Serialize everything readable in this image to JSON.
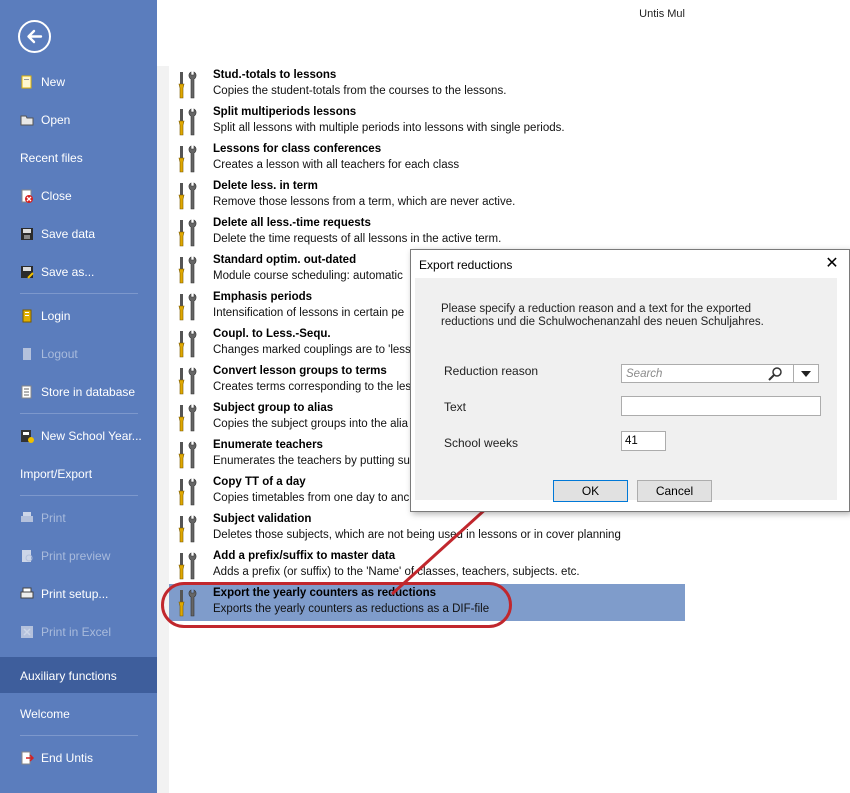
{
  "app": {
    "title": "Untis Mul"
  },
  "sidebar": {
    "items": [
      {
        "label": "New",
        "icon": "new-doc-icon",
        "disabled": false
      },
      {
        "label": "Open",
        "icon": "open-folder-icon",
        "disabled": false
      },
      {
        "label": "Recent files",
        "icon": "",
        "disabled": false
      },
      {
        "label": "Close",
        "icon": "close-doc-icon",
        "disabled": false
      },
      {
        "label": "Save data",
        "icon": "save-icon",
        "disabled": false
      },
      {
        "label": "Save as...",
        "icon": "save-as-icon",
        "disabled": false
      },
      {
        "label": "Login",
        "icon": "login-icon",
        "disabled": false
      },
      {
        "label": "Logout",
        "icon": "logout-icon",
        "disabled": true
      },
      {
        "label": "Store in database",
        "icon": "database-icon",
        "disabled": false
      },
      {
        "label": "New School Year...",
        "icon": "new-year-icon",
        "disabled": false
      },
      {
        "label": "Import/Export",
        "icon": "",
        "disabled": false
      },
      {
        "label": "Print",
        "icon": "print-icon",
        "disabled": true
      },
      {
        "label": "Print preview",
        "icon": "print-preview-icon",
        "disabled": true
      },
      {
        "label": "Print setup...",
        "icon": "print-setup-icon",
        "disabled": false
      },
      {
        "label": "Print in Excel",
        "icon": "excel-icon",
        "disabled": true
      },
      {
        "label": "Auxiliary functions",
        "icon": "",
        "disabled": false
      },
      {
        "label": "Welcome",
        "icon": "",
        "disabled": false
      },
      {
        "label": "End Untis",
        "icon": "exit-icon",
        "disabled": false
      }
    ]
  },
  "functions": [
    {
      "title": "Stud.-totals to lessons",
      "desc": "Copies the student-totals from the courses to the lessons."
    },
    {
      "title": "Split multiperiods lessons",
      "desc": "Split all lessons with multiple periods into lessons with single periods."
    },
    {
      "title": "Lessons for class conferences",
      "desc": "Creates a lesson with all teachers for each class"
    },
    {
      "title": "Delete less. in term",
      "desc": "Remove those lessons from a term, which are never active."
    },
    {
      "title": "Delete all less.-time requests",
      "desc": "Delete the time requests of all lessons in the active term."
    },
    {
      "title": "Standard optim. out-dated",
      "desc": "Module course scheduling: automatic"
    },
    {
      "title": "Emphasis periods",
      "desc": "Intensification of lessons in certain pe"
    },
    {
      "title": "Coupl. to Less.-Sequ.",
      "desc": "Changes marked couplings are to 'less"
    },
    {
      "title": "Convert lesson groups to terms",
      "desc": "Creates terms corresponding to the les"
    },
    {
      "title": "Subject group to alias",
      "desc": "Copies the subject groups into the alia"
    },
    {
      "title": "Enumerate teachers",
      "desc": "Enumerates the teachers by putting su"
    },
    {
      "title": "Copy TT of a day",
      "desc": "Copies timetables from one day to anc"
    },
    {
      "title": "Subject validation",
      "desc": "Deletes those subjects, which are not being used in lessons or in cover planning"
    },
    {
      "title": "Add a prefix/suffix to master data",
      "desc": "Adds a prefix (or suffix) to the 'Name' of classes, teachers, subjects. etc."
    },
    {
      "title": "Export the yearly counters as reductions",
      "desc": "Exports the yearly counters as reductions as a DIF-file"
    }
  ],
  "dialog": {
    "title": "Export reductions",
    "message": "Please specify a reduction reason and a text for the exported reductions und die Schulwochenanzahl des neuen Schuljahres.",
    "reason_label": "Reduction reason",
    "reason_placeholder": "Search",
    "text_label": "Text",
    "text_value": "",
    "weeks_label": "School weeks",
    "weeks_value": "41",
    "ok_label": "OK",
    "cancel_label": "Cancel"
  },
  "colors": {
    "sidebar": "#5b7dbd",
    "sidebar_active": "#3e5e9c",
    "selected_row": "#7f9ccb",
    "annotation": "#c1272d"
  }
}
